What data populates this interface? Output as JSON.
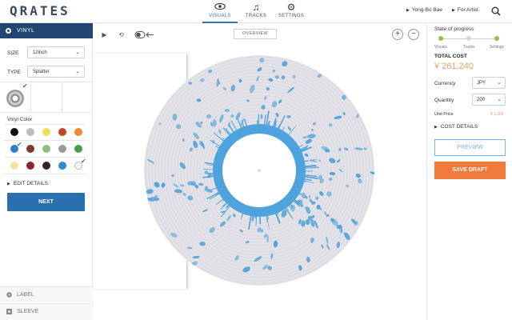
{
  "app": {
    "logo": "QRATES"
  },
  "nav": [
    {
      "label": "VISUALS",
      "icon": "eye-icon"
    },
    {
      "label": "TRACKS",
      "icon": "music-note-icon"
    },
    {
      "label": "SETTINGS",
      "icon": "gear-icon"
    }
  ],
  "user": {
    "name": "Yong-Bo Bae",
    "role": "For Artist"
  },
  "left": {
    "section": "VINYL",
    "size": {
      "label": "SIZE",
      "value": "12inch"
    },
    "type": {
      "label": "TYPE",
      "value": "Splatter"
    },
    "vinyl_color_label": "Vinyl Color",
    "colors": [
      "#111111",
      "#bdbdbd",
      "#f2dc5a",
      "#c8432e",
      "#ef8a2e",
      "#2f7fc4",
      "#7a3b2b",
      "#8dbf7a",
      "#9a9a9a",
      "#3fa24c",
      "#f5e49a",
      "#8e2430",
      "#3a1f2e",
      "#2f8dc9",
      "#f4f4f4"
    ],
    "selected_colors": [
      5,
      14
    ],
    "edit_details": "EDIT DETAILS",
    "next": "NEXT",
    "bottom_tabs": [
      "LABEL",
      "SLEEVE"
    ]
  },
  "center": {
    "overview": "OVERVIEW",
    "zoom_in": "+",
    "zoom_out": "−"
  },
  "right": {
    "progress_title": "State of progress",
    "steps": [
      "Visuals",
      "Tracks",
      "Settings"
    ],
    "step_status": [
      "done",
      "pending",
      "done"
    ],
    "total_label": "TOTAL COST",
    "total_value": "¥ 261,240",
    "currency": {
      "label": "Currency",
      "value": "JPY"
    },
    "quantity": {
      "label": "Quantity",
      "value": "200"
    },
    "unit_price": {
      "label": "Unit Price",
      "value": "¥ 1,306"
    },
    "cost_details": "COST DETAILS",
    "preview": "PREVIEW",
    "save": "SAVE DRAFT"
  },
  "colors": {
    "accent": "#2a6fb0",
    "orange": "#ee7a3c",
    "dark_header": "#214770",
    "splatter": "#4a9fd6",
    "green": "#8cc63f"
  }
}
